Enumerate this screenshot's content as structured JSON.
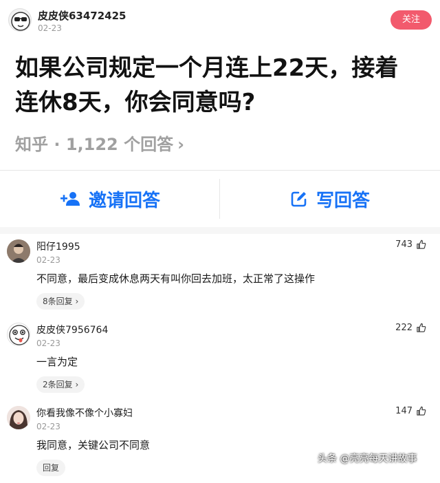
{
  "author": {
    "name": "皮皮侠63472425",
    "date": "02-23",
    "follow_label": "关注"
  },
  "question": {
    "title_line1": "如果公司规定一个月连上22天，接着",
    "title_line2": "连休8天，你会同意吗?",
    "meta": "知乎 · 1,122 个回答",
    "meta_chevron": "›"
  },
  "actions": {
    "invite_label": "邀请回答",
    "write_label": "写回答"
  },
  "colors": {
    "accent": "#1772f6",
    "follow": "#f25a6d"
  },
  "comments": [
    {
      "name": "阳仔1995",
      "date": "02-23",
      "text": "不同意，最后变成休息两天有叫你回去加班，太正常了这操作",
      "likes": "743",
      "reply_label": "8条回复 ›"
    },
    {
      "name": "皮皮侠7956764",
      "date": "02-23",
      "text": "一言为定",
      "likes": "222",
      "reply_label": "2条回复 ›"
    },
    {
      "name": "你看我像不像个小寡妇",
      "date": "02-23",
      "text": "我同意，关键公司不同意",
      "likes": "147",
      "reply_label": "回复"
    }
  ],
  "watermark": "头条 @亮亮每天讲故事"
}
